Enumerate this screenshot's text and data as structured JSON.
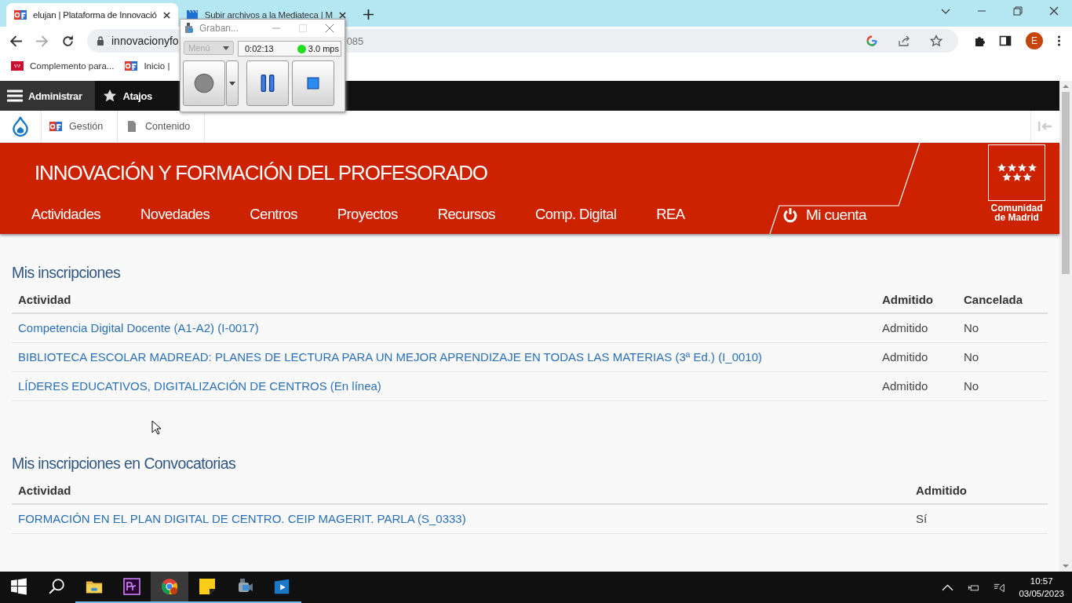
{
  "browser": {
    "tabs": [
      {
        "title": "elujan | Plataforma de Innovació",
        "selected": true
      },
      {
        "title": "Subir archivos a la Mediateca | M",
        "selected": false
      }
    ],
    "address_start": "innovacionyfo",
    "address_end": "085",
    "profile": "E",
    "bookmarks": [
      "Complemento para...",
      "Inicio |"
    ]
  },
  "admin_toolbar": {
    "items": [
      {
        "label": "Administrar",
        "selected": true
      },
      {
        "label": "Atajos",
        "selected": false
      }
    ],
    "tray": [
      "Gestión",
      "Contenido"
    ]
  },
  "site": {
    "title": "INNOVACIÓN Y FORMACIÓN DEL PROFESORADO",
    "nav": [
      "Actividades",
      "Novedades",
      "Centros",
      "Proyectos",
      "Recursos",
      "Comp. Digital",
      "REA"
    ],
    "account": "Mi cuenta",
    "logo_text": [
      "Comunidad",
      "de Madrid"
    ]
  },
  "sections": [
    {
      "title": "Mis inscripciones",
      "columns": [
        "Actividad",
        "Admitido",
        "Cancelada"
      ],
      "rows": [
        [
          "Competencia Digital Docente (A1-A2) (I-0017)",
          "Admitido",
          "No"
        ],
        [
          "BIBLIOTECA ESCOLAR MADREAD: PLANES DE LECTURA PARA UN MEJOR APRENDIZAJE EN TODAS LAS MATERIAS (3ª Ed.) (I_0010)",
          "Admitido",
          "No"
        ],
        [
          "LÍDERES EDUCATIVOS, DIGITALIZACIÓN DE CENTROS (En línea)",
          "Admitido",
          "No"
        ]
      ]
    },
    {
      "title": "Mis inscripciones en Convocatorias",
      "columns": [
        "Actividad",
        "Admitido"
      ],
      "rows": [
        [
          "FORMACIÓN EN EL PLAN DIGITAL DE CENTRO. CEIP MAGERIT. PARLA (S_0333)",
          "Sí"
        ]
      ]
    }
  ],
  "recorder": {
    "title": "Graban...",
    "menu": "Menú",
    "time": "0:02:13",
    "rate": "3.0 mps"
  },
  "taskbar": {
    "apps": [
      {
        "kind": "start",
        "running": false,
        "selected": false
      },
      {
        "kind": "search",
        "running": false,
        "selected": false
      },
      {
        "kind": "folder",
        "running": true,
        "selected": false
      },
      {
        "kind": "premiere",
        "running": true,
        "selected": false
      },
      {
        "kind": "chrome",
        "running": true,
        "selected": true
      },
      {
        "kind": "notes",
        "running": true,
        "selected": false
      },
      {
        "kind": "camera",
        "running": true,
        "selected": false
      },
      {
        "kind": "player",
        "running": true,
        "selected": false
      }
    ],
    "time": "10:57",
    "date": "03/05/2023"
  }
}
